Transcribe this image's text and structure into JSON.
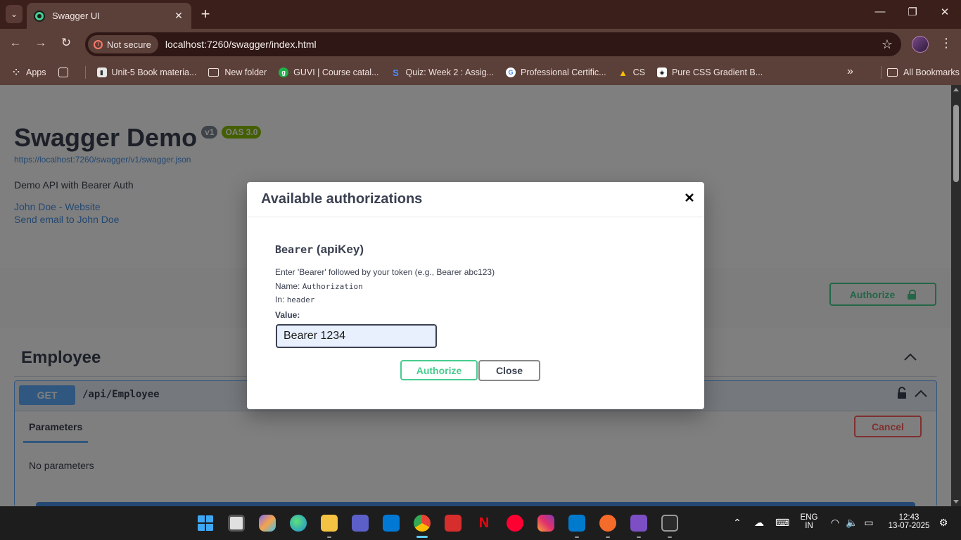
{
  "browser": {
    "tab_title": "Swagger UI",
    "security_label": "Not secure",
    "url": "localhost:7260/swagger/index.html",
    "bookmarks": [
      {
        "label": "Apps",
        "icon": "apps-grid-icon"
      },
      {
        "label": "",
        "icon": "grid-icon"
      },
      {
        "label": "Unit-5 Book materia...",
        "icon": "doc-icon"
      },
      {
        "label": "New folder",
        "icon": "folder-icon"
      },
      {
        "label": "GUVI | Course catal...",
        "icon": "guvi-icon"
      },
      {
        "label": "Quiz: Week 2 : Assig...",
        "icon": "swayam-icon"
      },
      {
        "label": "Professional Certific...",
        "icon": "google-icon"
      },
      {
        "label": "CS",
        "icon": "drive-icon"
      },
      {
        "label": "Pure CSS Gradient B...",
        "icon": "codepen-icon"
      }
    ],
    "all_bookmarks": "All Bookmarks",
    "bookmarks_overflow": "»"
  },
  "swagger": {
    "title": "Swagger Demo",
    "version": "v1",
    "oas": "OAS 3.0",
    "spec_url": "https://localhost:7260/swagger/v1/swagger.json",
    "description": "Demo API with Bearer Auth",
    "contact_website": "John Doe - Website",
    "contact_email": "Send email to John Doe",
    "authorize_label": "Authorize",
    "section": "Employee",
    "operation": {
      "method": "GET",
      "path": "/api/Employee",
      "tab_label": "Parameters",
      "cancel_label": "Cancel",
      "no_params": "No parameters"
    }
  },
  "modal": {
    "title": "Available authorizations",
    "close_glyph": "×",
    "scheme_name": "Bearer",
    "scheme_type": "(apiKey)",
    "description": "Enter 'Bearer' followed by your token (e.g., Bearer abc123)",
    "name_label": "Name:",
    "name_value": "Authorization",
    "in_label": "In:",
    "in_value": "header",
    "value_label": "Value:",
    "value": "Bearer 1234",
    "authorize_label": "Authorize",
    "close_label": "Close"
  },
  "taskbar": {
    "language_line1": "ENG",
    "language_line2": "IN",
    "time": "12:43",
    "date": "13-07-2025"
  },
  "colors": {
    "accent_green": "#49cc90",
    "get_blue": "#61affe",
    "cancel_red": "#ff6060",
    "chrome_frame": "#5b3f39"
  }
}
